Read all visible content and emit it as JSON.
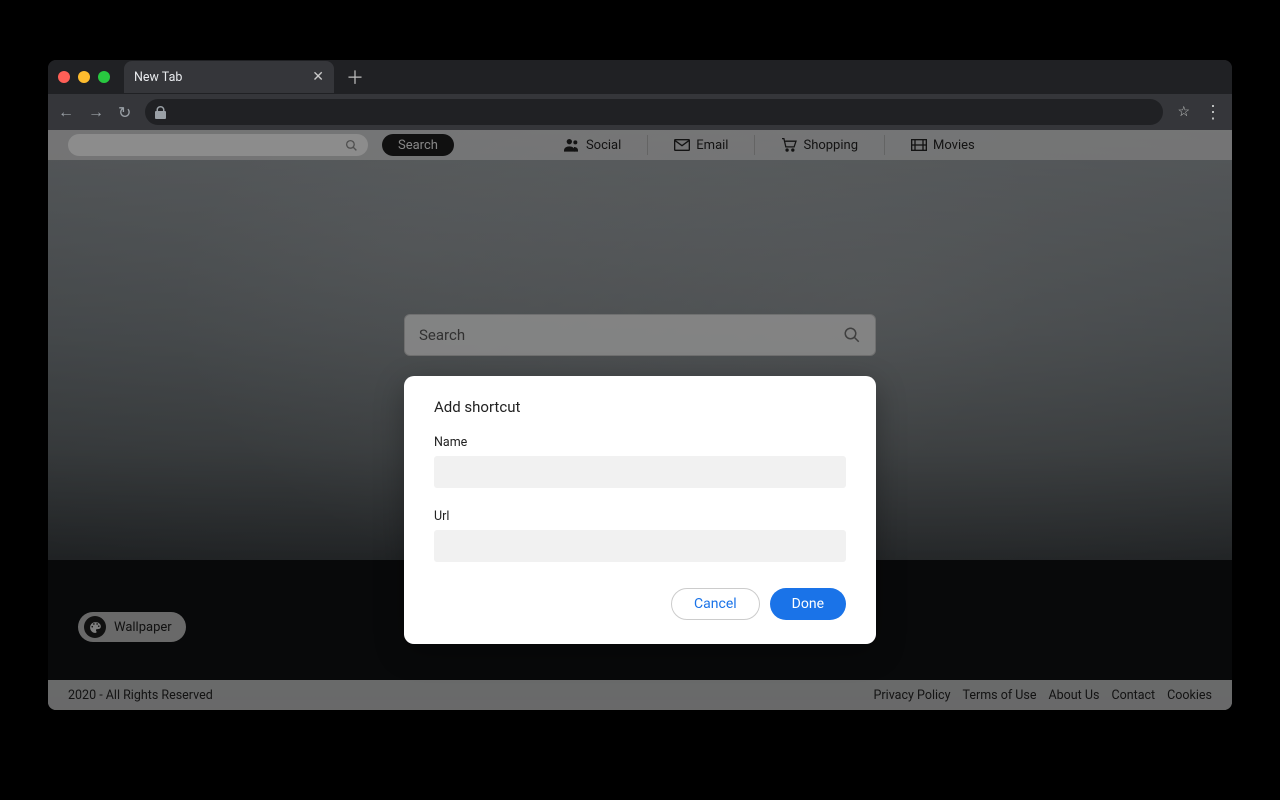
{
  "tab": {
    "title": "New Tab"
  },
  "topnav": {
    "search_button_label": "Search",
    "items": [
      {
        "label": "Social",
        "icon": "users-icon"
      },
      {
        "label": "Email",
        "icon": "mail-icon"
      },
      {
        "label": "Shopping",
        "icon": "cart-icon"
      },
      {
        "label": "Movies",
        "icon": "film-icon"
      }
    ]
  },
  "bigsearch": {
    "placeholder": "Search"
  },
  "wallpaper_button": "Wallpaper",
  "footer": {
    "copyright": "2020 - All Rights Reserved",
    "links": [
      "Privacy Policy",
      "Terms of Use",
      "About Us",
      "Contact",
      "Cookies"
    ]
  },
  "modal": {
    "title": "Add shortcut",
    "name_label": "Name",
    "name_value": "",
    "url_label": "Url",
    "url_value": "",
    "cancel": "Cancel",
    "done": "Done"
  }
}
